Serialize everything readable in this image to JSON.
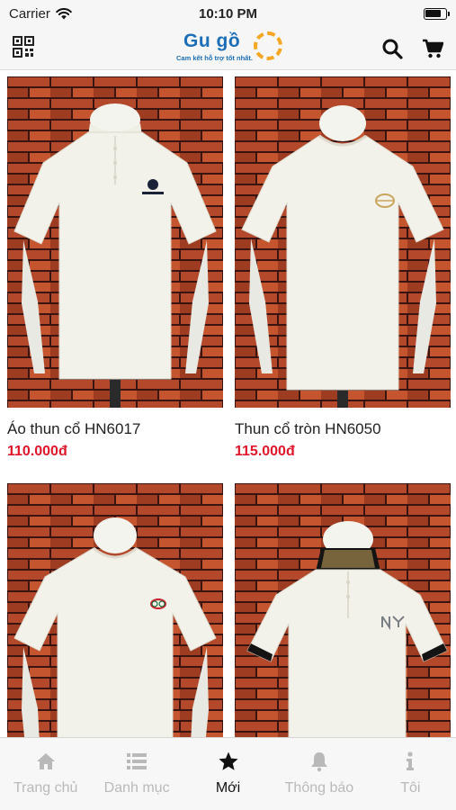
{
  "status_bar": {
    "carrier": "Carrier",
    "time": "10:10 PM"
  },
  "header": {
    "logo_text": "Gu gồ",
    "logo_tagline": "Cam kết hỗ trợ tốt nhất.",
    "icons": [
      "qr-code-icon",
      "search-icon",
      "cart-icon"
    ]
  },
  "products": [
    {
      "name": "Áo thun cổ HN6017",
      "price": "110.000đ",
      "emblem": "black-logo",
      "emblem_color": "#1a2238"
    },
    {
      "name": "Thun cổ tròn HN6050",
      "price": "115.000đ",
      "emblem": "gold-crest",
      "emblem_color": "#c9a45c"
    },
    {
      "name": "",
      "price": "",
      "emblem": "red-gg-logo",
      "emblem_color": "#c8202a"
    },
    {
      "name": "",
      "price": "",
      "emblem": "grey-ny-logo",
      "emblem_color": "#7a7f86"
    }
  ],
  "tabs": [
    {
      "label": "Trang chủ",
      "icon": "home-icon",
      "active": false
    },
    {
      "label": "Danh mục",
      "icon": "list-icon",
      "active": false
    },
    {
      "label": "Mới",
      "icon": "star-icon",
      "active": true
    },
    {
      "label": "Thông báo",
      "icon": "bell-icon",
      "active": false
    },
    {
      "label": "Tôi",
      "icon": "info-icon",
      "active": false
    }
  ],
  "colors": {
    "brand": "#1c6fb6",
    "accent": "#f5a623",
    "price": "#e0162b",
    "tab_active": "#111111",
    "tab_inactive": "#b9b9b9"
  }
}
